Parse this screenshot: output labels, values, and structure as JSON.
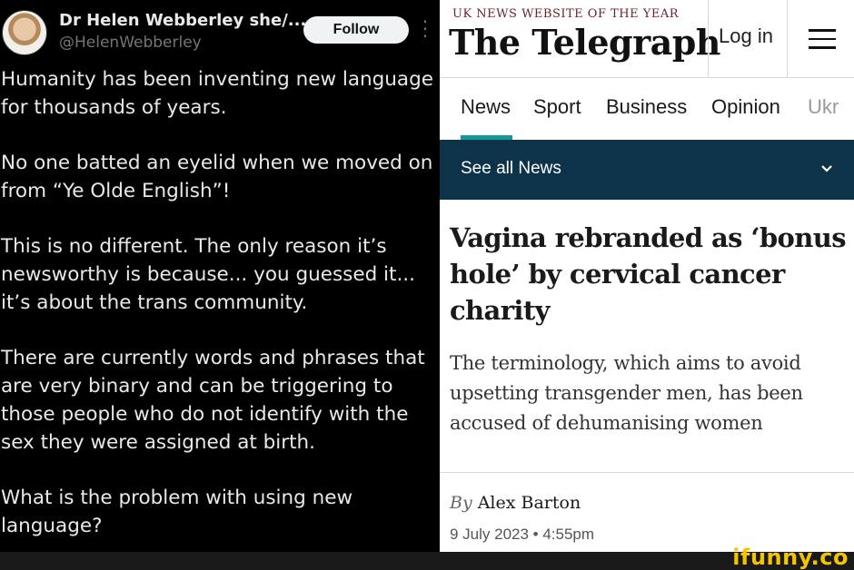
{
  "tweet": {
    "author_name": "Dr Helen Webberley she/...",
    "handle": "@HelenWebberley",
    "follow_label": "Follow",
    "more_icon": "more-vertical-icon",
    "paragraphs": [
      "Humanity has been inventing new language for thousands of years.",
      "No one batted an eyelid when we moved on from “Ye Olde English”!",
      "This is no different. The only reason it’s newsworthy is because... you guessed it... it’s about the trans community.",
      "There are currently words and phrases that are very binary and can be triggering to those people who do not identify with the sex they were assigned at birth.",
      "What is the problem with using new language?"
    ]
  },
  "telegraph": {
    "tagline": "UK NEWS WEBSITE OF THE YEAR",
    "logo": "The Telegraph",
    "login_label": "Log in",
    "menu_icon": "hamburger-menu-icon",
    "nav": [
      "News",
      "Sport",
      "Business",
      "Opinion",
      "Ukr"
    ],
    "active_nav": "News",
    "see_all_label": "See all News",
    "headline": "Vagina rebranded as ‘bonus hole’ by cervical cancer charity",
    "standfirst": "The terminology, which aims to avoid upsetting transgender men, has been accused of dehumanising women",
    "byline_prefix": "By",
    "author": "Alex Barton",
    "date": "9 July 2023 • 4:55pm",
    "colors": {
      "nav_accent": "#15989a",
      "see_all_bg": "#0d3349"
    }
  },
  "watermark": "ifunny.co"
}
